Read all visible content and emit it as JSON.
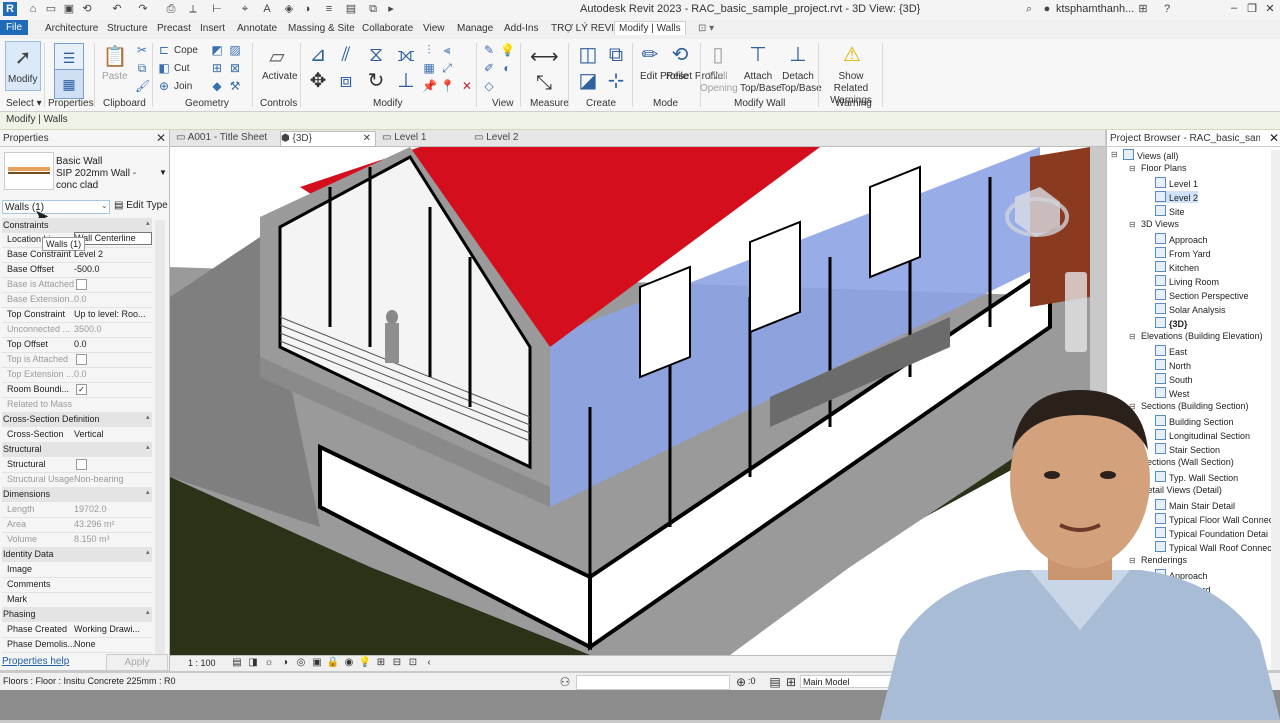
{
  "app": {
    "title": "Autodesk Revit 2023 - RAC_basic_sample_project.rvt - 3D View: {3D}",
    "user": "ktsphamthanh..."
  },
  "tabs": [
    "Architecture",
    "Structure",
    "Precast",
    "Insert",
    "Annotate",
    "Massing & Site",
    "Collaborate",
    "View",
    "Manage",
    "Add-Ins",
    "TRỢ LÝ REVIT"
  ],
  "file_tab": "File",
  "active_tab": "Modify | Walls",
  "ribbon": {
    "modify": "Modify",
    "paste": "Paste",
    "cope": "Cope",
    "cut": "Cut",
    "join": "Join",
    "activate": "Activate",
    "edit_profile": "Edit Profile",
    "reset_profile": "Reset Profile",
    "wall_opening": "Wall Opening",
    "attach": "Attach Top/Base",
    "detach": "Detach Top/Base",
    "show_warnings": "Show Related Warnings",
    "panels": [
      "Select",
      "Properties",
      "Clipboard",
      "Geometry",
      "Controls",
      "Modify",
      "View",
      "Measure",
      "Create",
      "Mode",
      "Modify Wall",
      "Warning"
    ]
  },
  "context_bar": "Modify | Walls",
  "properties": {
    "title": "Properties",
    "type_family": "Basic Wall",
    "type_name": "SIP 202mm Wall - conc clad",
    "filter": "Walls (1)",
    "edit_type": "Edit Type",
    "tooltip": "Walls (1)",
    "help": "Properties help",
    "apply": "Apply",
    "groups": {
      "constraints": "Constraints",
      "cross_section": "Cross-Section Definition",
      "structural": "Structural",
      "dimensions": "Dimensions",
      "identity": "Identity Data",
      "phasing": "Phasing"
    },
    "rows": {
      "location_line": {
        "k": "Location Line",
        "v": "Wall Centerline"
      },
      "base_constraint": {
        "k": "Base Constraint",
        "v": "Level 2"
      },
      "base_offset": {
        "k": "Base Offset",
        "v": "-500.0"
      },
      "base_attached": {
        "k": "Base is Attached",
        "v": ""
      },
      "base_extension": {
        "k": "Base Extension...",
        "v": "0.0"
      },
      "top_constraint": {
        "k": "Top Constraint",
        "v": "Up to level: Roo..."
      },
      "unconnected": {
        "k": "Unconnected ...",
        "v": "3500.0"
      },
      "top_offset": {
        "k": "Top Offset",
        "v": "0.0"
      },
      "top_attached": {
        "k": "Top is Attached",
        "v": ""
      },
      "top_extension": {
        "k": "Top Extension ...",
        "v": "0.0"
      },
      "room_bounding": {
        "k": "Room Boundi...",
        "v": "✓"
      },
      "related_mass": {
        "k": "Related to Mass",
        "v": ""
      },
      "cross_section": {
        "k": "Cross-Section",
        "v": "Vertical"
      },
      "structural": {
        "k": "Structural",
        "v": ""
      },
      "structural_usage": {
        "k": "Structural Usage",
        "v": "Non-bearing"
      },
      "length": {
        "k": "Length",
        "v": "19702.0"
      },
      "area": {
        "k": "Area",
        "v": "43.296 m²"
      },
      "volume": {
        "k": "Volume",
        "v": "8.150 m³"
      },
      "image": {
        "k": "Image",
        "v": ""
      },
      "comments": {
        "k": "Comments",
        "v": ""
      },
      "mark": {
        "k": "Mark",
        "v": ""
      },
      "phase_created": {
        "k": "Phase Created",
        "v": "Working Drawi..."
      },
      "phase_demolished": {
        "k": "Phase Demolis...",
        "v": "None"
      }
    }
  },
  "view_tabs": [
    "A001 - Title Sheet",
    "{3D}",
    "Level 1",
    "Level 2"
  ],
  "view_scale": "1 : 100",
  "browser": {
    "title": "Project Browser - RAC_basic_sample_...",
    "views_all": "Views (all)",
    "floor_plans": "Floor Plans",
    "floor_plan_items": [
      "Level 1",
      "Level 2",
      "Site"
    ],
    "views_3d": "3D Views",
    "views_3d_items": [
      "Approach",
      "From Yard",
      "Kitchen",
      "Living Room",
      "Section Perspective",
      "Solar Analysis",
      "{3D}"
    ],
    "elevations": "Elevations (Building Elevation)",
    "elevation_items": [
      "East",
      "North",
      "South",
      "West"
    ],
    "sections_building": "Sections (Building Section)",
    "section_items": [
      "Building Section",
      "Longitudinal Section",
      "Stair Section"
    ],
    "sections_wall": "Sections (Wall Section)",
    "wall_section_items": [
      "Typ. Wall Section"
    ],
    "detail_views": "Detail Views (Detail)",
    "detail_items": [
      "Main Stair Detail",
      "Typical Floor Wall Connec",
      "Typical Foundation Detai",
      "Typical Wall Roof Connec"
    ],
    "renderings": "Renderings",
    "rendering_items": [
      "Approach",
      "From Yard"
    ]
  },
  "status": {
    "text": "Floors : Floor : Insitu Concrete 225mm : R0",
    "zero": ":0",
    "model": "Main Model"
  }
}
